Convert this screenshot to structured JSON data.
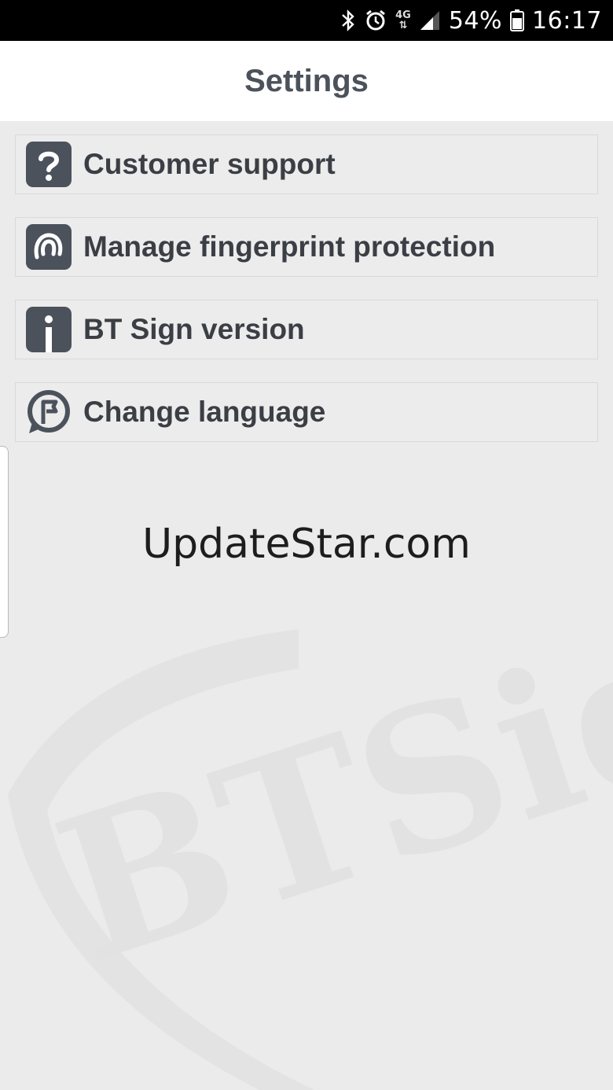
{
  "status_bar": {
    "battery_percent": "54%",
    "time": "16:17",
    "network": "4G",
    "icons": [
      "bluetooth-icon",
      "alarm-icon",
      "network-4g-icon",
      "signal-icon",
      "battery-icon"
    ]
  },
  "header": {
    "title": "Settings"
  },
  "settings": {
    "items": [
      {
        "label": "Customer support",
        "icon": "question-icon"
      },
      {
        "label": "Manage fingerprint protection",
        "icon": "fingerprint-icon"
      },
      {
        "label": "BT Sign version",
        "icon": "info-icon"
      },
      {
        "label": "Change language",
        "icon": "language-flag-icon"
      }
    ]
  },
  "overlay_text": "UpdateStar.com",
  "watermark": {
    "text": "BTSign"
  },
  "colors": {
    "icon_bg": "#4b525b",
    "label": "#3b3f45",
    "title": "#4b525b",
    "background": "#ebebeb"
  }
}
